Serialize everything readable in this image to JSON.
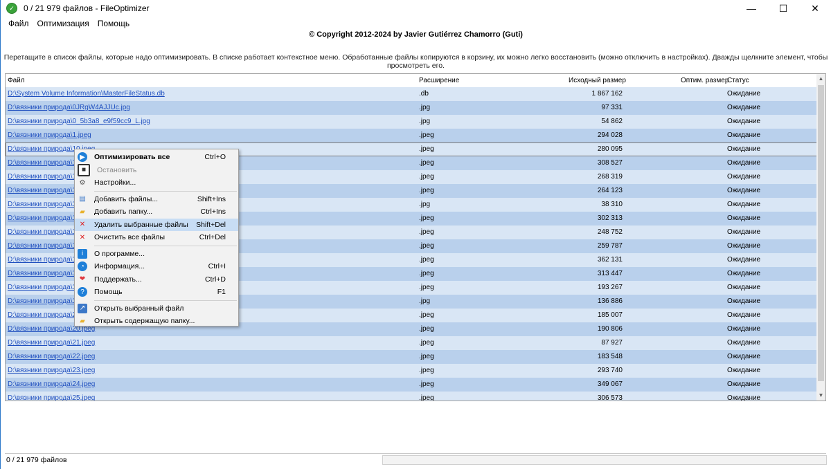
{
  "window": {
    "title": "0 / 21 979 файлов - FileOptimizer",
    "minimize": "—",
    "maximize": "☐",
    "close": "✕"
  },
  "menu": [
    "Файл",
    "Оптимизация",
    "Помощь"
  ],
  "copyright": "© Copyright 2012-2024 by Javier Gutiérrez Chamorro (Guti)",
  "hint": "Перетащите в список файлы, которые надо оптимизировать. В списке работает контекстное меню. Обработанные файлы копируются в корзину, их можно легко восстановить (можно отключить в настройках). Дважды щелкните элемент, чтобы просмотреть его.",
  "columns": {
    "file": "Файл",
    "ext": "Расширение",
    "size": "Исходный размер",
    "opt": "Оптим. размер",
    "status": "Статус"
  },
  "rows": [
    {
      "file": "D:\\System Volume Information\\MasterFileStatus.db",
      "ext": ".db",
      "size": "1 867 162",
      "status": "Ожидание"
    },
    {
      "file": "D:\\вязники природа\\0JRgW4AJJUc.jpg",
      "ext": ".jpg",
      "size": "97 331",
      "status": "Ожидание"
    },
    {
      "file": "D:\\вязники природа\\0_5b3a8_e9f59cc9_L.jpg",
      "ext": ".jpg",
      "size": "54 862",
      "status": "Ожидание"
    },
    {
      "file": "D:\\вязники природа\\1.jpeg",
      "ext": ".jpeg",
      "size": "294 028",
      "status": "Ожидание"
    },
    {
      "file": "D:\\вязники природа\\10.jpeg",
      "ext": ".jpeg",
      "size": "280 095",
      "status": "Ожидание"
    },
    {
      "file": "D:\\вязники природа\\11.jpeg",
      "ext": ".jpeg",
      "size": "308 527",
      "status": "Ожидание"
    },
    {
      "file": "D:\\вязники природа\\12.jpeg",
      "ext": ".jpeg",
      "size": "268 319",
      "status": "Ожидание"
    },
    {
      "file": "D:\\вязники природа\\13.jpeg",
      "ext": ".jpeg",
      "size": "264 123",
      "status": "Ожидание"
    },
    {
      "file": "D:\\вязники природа\\14.jpg",
      "ext": ".jpg",
      "size": "38 310",
      "status": "Ожидание"
    },
    {
      "file": "D:\\вязники природа\\15.jpeg",
      "ext": ".jpeg",
      "size": "302 313",
      "status": "Ожидание"
    },
    {
      "file": "D:\\вязники природа\\16.jpeg",
      "ext": ".jpeg",
      "size": "248 752",
      "status": "Ожидание"
    },
    {
      "file": "D:\\вязники природа\\17.jpeg",
      "ext": ".jpeg",
      "size": "259 787",
      "status": "Ожидание"
    },
    {
      "file": "D:\\вязники природа\\18.jpeg",
      "ext": ".jpeg",
      "size": "362 131",
      "status": "Ожидание"
    },
    {
      "file": "D:\\вязники природа\\19.jpeg",
      "ext": ".jpeg",
      "size": "313 447",
      "status": "Ожидание"
    },
    {
      "file": "D:\\вязники природа\\1a.jpeg",
      "ext": ".jpeg",
      "size": "193 267",
      "status": "Ожидание"
    },
    {
      "file": "D:\\вязники природа\\1b.jpg",
      "ext": ".jpg",
      "size": "136 886",
      "status": "Ожидание"
    },
    {
      "file": "D:\\вязники природа\\2.jpeg",
      "ext": ".jpeg",
      "size": "185 007",
      "status": "Ожидание"
    },
    {
      "file": "D:\\вязники природа\\20.jpeg",
      "ext": ".jpeg",
      "size": "190 806",
      "status": "Ожидание"
    },
    {
      "file": "D:\\вязники природа\\21.jpeg",
      "ext": ".jpeg",
      "size": "87 927",
      "status": "Ожидание"
    },
    {
      "file": "D:\\вязники природа\\22.jpeg",
      "ext": ".jpeg",
      "size": "183 548",
      "status": "Ожидание"
    },
    {
      "file": "D:\\вязники природа\\23.jpeg",
      "ext": ".jpeg",
      "size": "293 740",
      "status": "Ожидание"
    },
    {
      "file": "D:\\вязники природа\\24.jpeg",
      "ext": ".jpeg",
      "size": "349 067",
      "status": "Ожидание"
    },
    {
      "file": "D:\\вязники природа\\25.jpeg",
      "ext": ".jpeg",
      "size": "306 573",
      "status": "Ожидание"
    }
  ],
  "focused_row": 4,
  "context_menu": [
    {
      "label": "Оптимизировать все",
      "shortcut": "Ctrl+O",
      "icon": "play-icon",
      "bold": true
    },
    {
      "label": "Остановить",
      "shortcut": "",
      "icon": "stop-icon",
      "disabled": true
    },
    {
      "label": "Настройки...",
      "shortcut": "",
      "icon": "gear-icon"
    },
    {
      "sep": true
    },
    {
      "label": "Добавить файлы...",
      "shortcut": "Shift+Ins",
      "icon": "add-file-icon"
    },
    {
      "label": "Добавить папку...",
      "shortcut": "Ctrl+Ins",
      "icon": "add-folder-icon"
    },
    {
      "label": "Удалить выбранные файлы",
      "shortcut": "Shift+Del",
      "icon": "red-x-icon",
      "highlight": true
    },
    {
      "label": "Очистить все файлы",
      "shortcut": "Ctrl+Del",
      "icon": "red-x-icon"
    },
    {
      "sep": true
    },
    {
      "label": "О программе...",
      "shortcut": "",
      "icon": "info-icon"
    },
    {
      "label": "Информация...",
      "shortcut": "Ctrl+I",
      "icon": "chart-icon"
    },
    {
      "label": "Поддержать...",
      "shortcut": "Ctrl+D",
      "icon": "heart-icon"
    },
    {
      "label": "Помощь",
      "shortcut": "F1",
      "icon": "help-icon"
    },
    {
      "sep": true
    },
    {
      "label": "Открыть выбранный файл",
      "shortcut": "",
      "icon": "open-file-icon"
    },
    {
      "label": "Открыть содержащую папку...",
      "shortcut": "",
      "icon": "open-folder-icon"
    }
  ],
  "status": {
    "count": "0 / 21 979 файлов"
  }
}
